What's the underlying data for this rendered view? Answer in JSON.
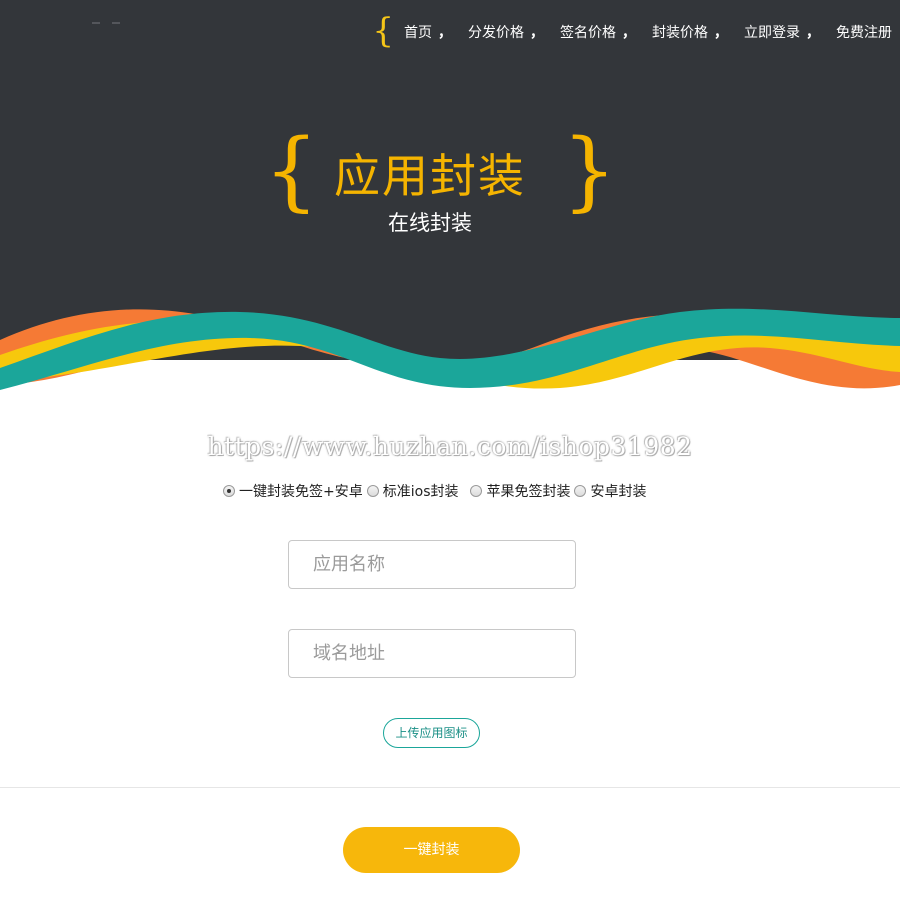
{
  "nav": {
    "items": [
      {
        "label": "首页",
        "sep": "，"
      },
      {
        "label": "分发价格",
        "sep": "，"
      },
      {
        "label": "签名价格",
        "sep": "，"
      },
      {
        "label": "封装价格",
        "sep": "，"
      },
      {
        "label": "立即登录",
        "sep": "，"
      },
      {
        "label": "免费注册",
        "sep": ""
      }
    ],
    "brace": "{"
  },
  "hero": {
    "brace_left": "{",
    "brace_right": "}",
    "title": "应用封装",
    "subtitle": "在线封装"
  },
  "watermark": "https://www.huzhan.com/ishop31982",
  "options": [
    {
      "label": "一键封装免签+安卓",
      "checked": true
    },
    {
      "label": "标准ios封装",
      "checked": false
    },
    {
      "label": "苹果免签封装",
      "checked": false
    },
    {
      "label": "安卓封装",
      "checked": false
    }
  ],
  "form": {
    "app_name_placeholder": "应用名称",
    "domain_placeholder": "域名地址",
    "upload_label": "上传应用图标",
    "submit_label": "一键封装"
  },
  "colors": {
    "dark_bg": "#33363a",
    "accent_yellow": "#f5b400",
    "wave_teal": "#1ba69a",
    "wave_yellow": "#f7c80c",
    "wave_orange": "#f57a35"
  }
}
